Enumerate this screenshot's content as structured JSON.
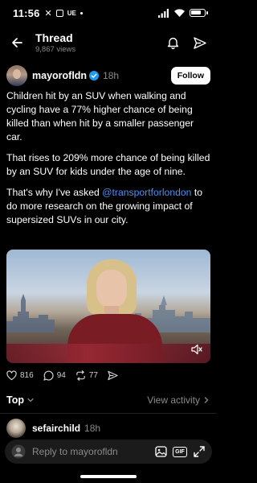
{
  "status_bar": {
    "time": "11:56",
    "carrier_badge": "UE"
  },
  "header": {
    "title": "Thread",
    "views": "9,867 views"
  },
  "post": {
    "author": "mayorofldn",
    "time": "18h",
    "follow_label": "Follow",
    "paragraph_1": "Children hit by an SUV when walking and cycling have a 77% higher chance of being killed than when hit by a smaller passenger car.",
    "paragraph_2": "That rises to 209% more chance of being killed by an SUV for kids under the age of nine.",
    "paragraph_3_before": "That's why I've asked ",
    "mention": "@transportforlondon",
    "paragraph_3_after": " to do more research on the growing impact of supersized SUVs in our city."
  },
  "engagement": {
    "likes": "816",
    "comments": "94",
    "reposts": "77"
  },
  "sort": {
    "label": "Top",
    "view_activity": "View activity"
  },
  "reply_preview": {
    "name": "sefairchild",
    "time": "18h"
  },
  "reply_bar": {
    "placeholder": "Reply to mayorofldn",
    "gif_label": "GIF"
  },
  "icons": {
    "back": "back-arrow-icon",
    "notify": "bell-icon",
    "share": "send-icon",
    "like": "heart-icon",
    "comment": "comment-icon",
    "repost": "repost-icon",
    "send": "send-icon",
    "mute": "mute-icon",
    "image": "image-icon",
    "expand": "expand-icon"
  },
  "colors": {
    "background": "#000000",
    "mention": "#4f8ff7",
    "verified": "#1d9bf0",
    "muted": "#8a8a8a"
  }
}
